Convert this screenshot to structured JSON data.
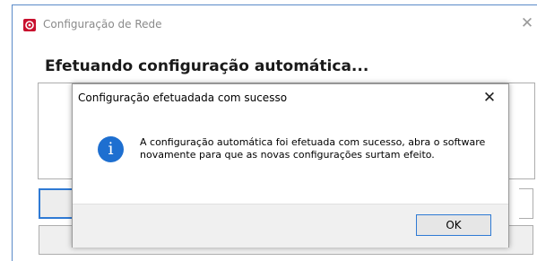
{
  "window": {
    "title": "Configuração de Rede",
    "close_glyph": "✕",
    "icon": "app-logo-icon",
    "heading": "Efetuando configuração automática..."
  },
  "dialog": {
    "title": "Configuração efetuadada com sucesso",
    "close_glyph": "✕",
    "icon": "info-icon",
    "icon_glyph": "i",
    "message": "A configuração automática foi efetuada com sucesso, abra o software novamente para que as novas configurações surtam efeito.",
    "ok_label": "OK"
  },
  "colors": {
    "app_icon": "#c8102e",
    "info_icon": "#1e6fd0",
    "focus_border": "#2f7ad4"
  }
}
